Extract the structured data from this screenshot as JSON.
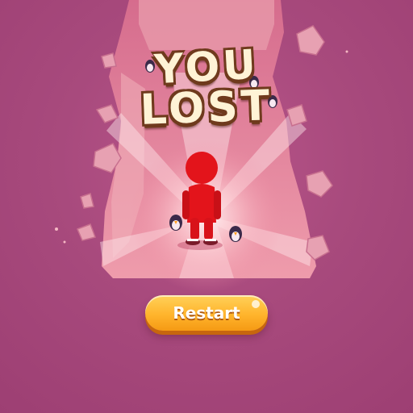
{
  "game": {
    "title_line1": "YOU",
    "title_line2": "LOST",
    "restart_label": "Restart"
  },
  "colors": {
    "background": "#a6457a",
    "platform": "#e58aa0",
    "player": "#e3141b",
    "button": "#ffb42c",
    "title_fill": "#fff3d6",
    "title_outline": "#6f3a1d"
  },
  "icons": {
    "player": "red-stickman-character",
    "enemies": "penguin-figures"
  }
}
